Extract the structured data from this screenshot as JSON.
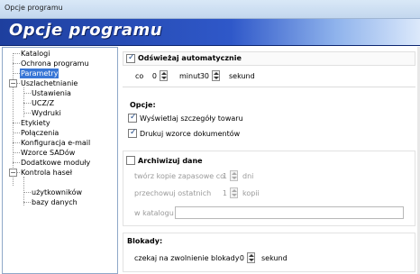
{
  "window": {
    "title": "Opcje programu"
  },
  "banner": {
    "title": "Opcje programu"
  },
  "tree": {
    "items": [
      {
        "label": "Katalogi"
      },
      {
        "label": "Ochrona programu"
      },
      {
        "label": "Parametry",
        "selected": true
      },
      {
        "label": "Uszlachetnianie",
        "expander": "−"
      },
      {
        "label": "Ustawienia"
      },
      {
        "label": "UCZ/Z"
      },
      {
        "label": "Wydruki"
      },
      {
        "label": "Etykiety"
      },
      {
        "label": "Połączenia"
      },
      {
        "label": "Konfiguracja e-mail"
      },
      {
        "label": "Wzorce SADów"
      },
      {
        "label": "Dodatkowe moduły"
      },
      {
        "label": "Kontrola haseł",
        "expander": "−"
      },
      {
        "label": "użytkowników"
      },
      {
        "label": "bazy danych"
      }
    ]
  },
  "refresh": {
    "label": "Odświeżaj automatycznie",
    "checked": true,
    "co_label": "co",
    "minutes": "0",
    "minutes_label": "minut",
    "seconds": "30",
    "seconds_label": "sekund"
  },
  "options": {
    "header": "Opcje:",
    "show_details": "Wyświetlaj szczegóły towaru",
    "print_templates": "Drukuj wzorce dokumentów"
  },
  "archive": {
    "label": "Archiwizuj dane",
    "checked": false,
    "backup_label": "twórz kopie zapasowe co",
    "backup_value": "1",
    "backup_unit": "dni",
    "keep_label": "przechowuj ostatnich",
    "keep_value": "1",
    "keep_unit": "kopii",
    "dir_label": "w katalogu",
    "dir_value": ""
  },
  "locks": {
    "header": "Blokady:",
    "wait_label": "czekaj na zwolnienie blokady",
    "wait_value": "0",
    "wait_unit": "sekund"
  }
}
